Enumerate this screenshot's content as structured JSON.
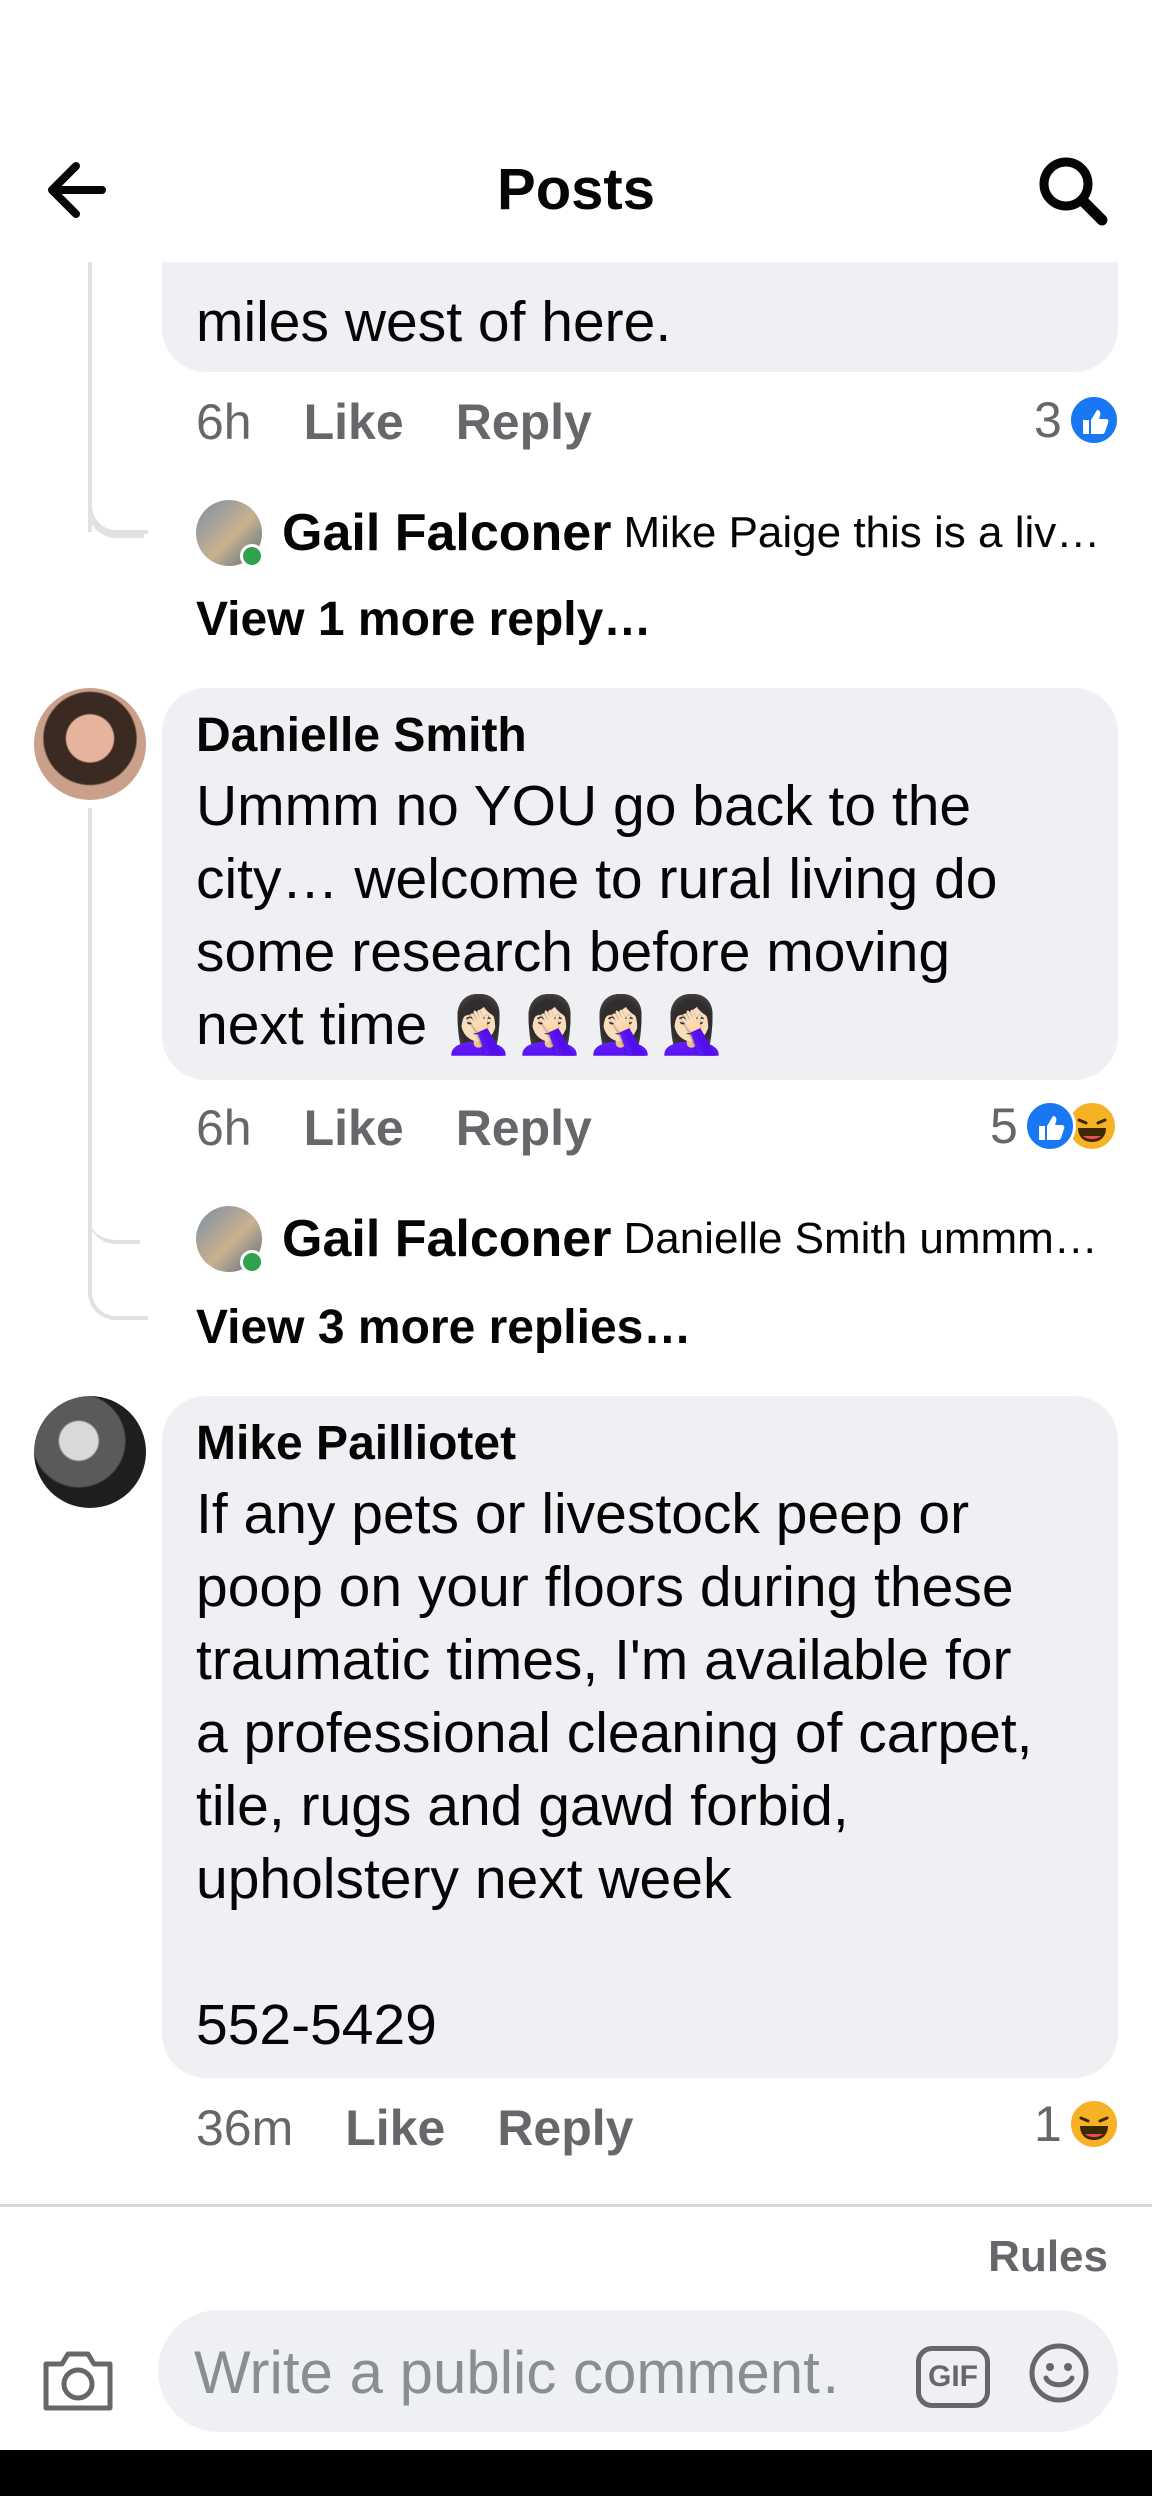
{
  "header": {
    "title": "Posts"
  },
  "comment_top": {
    "partial_text": "miles west of here.",
    "time": "6h",
    "like": "Like",
    "reply": "Reply",
    "reaction_count": "3",
    "reply_preview": {
      "name": "Gail Falconer",
      "text": "Mike Paige this is a live…"
    },
    "more_replies": "View 1 more reply…"
  },
  "comment_danielle": {
    "author": "Danielle Smith",
    "text": "Ummm no YOU go back to the city… welcome to rural living do some research before moving next time 🤦🏻‍♀️🤦🏻‍♀️🤦🏻‍♀️🤦🏻‍♀️",
    "time": "6h",
    "like": "Like",
    "reply": "Reply",
    "reaction_count": "5",
    "reply_preview": {
      "name": "Gail Falconer",
      "text": "Danielle Smith ummm…"
    },
    "more_replies": "View 3 more replies…"
  },
  "comment_mike": {
    "author": "Mike Pailliotet",
    "text_lines": [
      "If any pets or livestock peep or",
      "poop on your floors during these",
      "traumatic times, I'm available for",
      "a professional cleaning of carpet,",
      "tile, rugs and gawd forbid,",
      "upholstery next week",
      "",
      "552-5429"
    ],
    "time": "36m",
    "like": "Like",
    "reply": "Reply",
    "reaction_count": "1"
  },
  "composer": {
    "rules": "Rules",
    "placeholder": "Write a public comment…",
    "gif_label": "GIF"
  },
  "icons": {
    "back": "arrow-left-icon",
    "search": "search-icon",
    "camera": "camera-icon",
    "emoji": "smiley-icon",
    "like_reaction": "like-reaction-icon",
    "haha_reaction": "haha-reaction-icon"
  },
  "colors": {
    "like_blue": "#1877f2",
    "haha_yellow": "#f7b125",
    "bubble": "#eff0f3",
    "meta_gray": "#65676b"
  }
}
